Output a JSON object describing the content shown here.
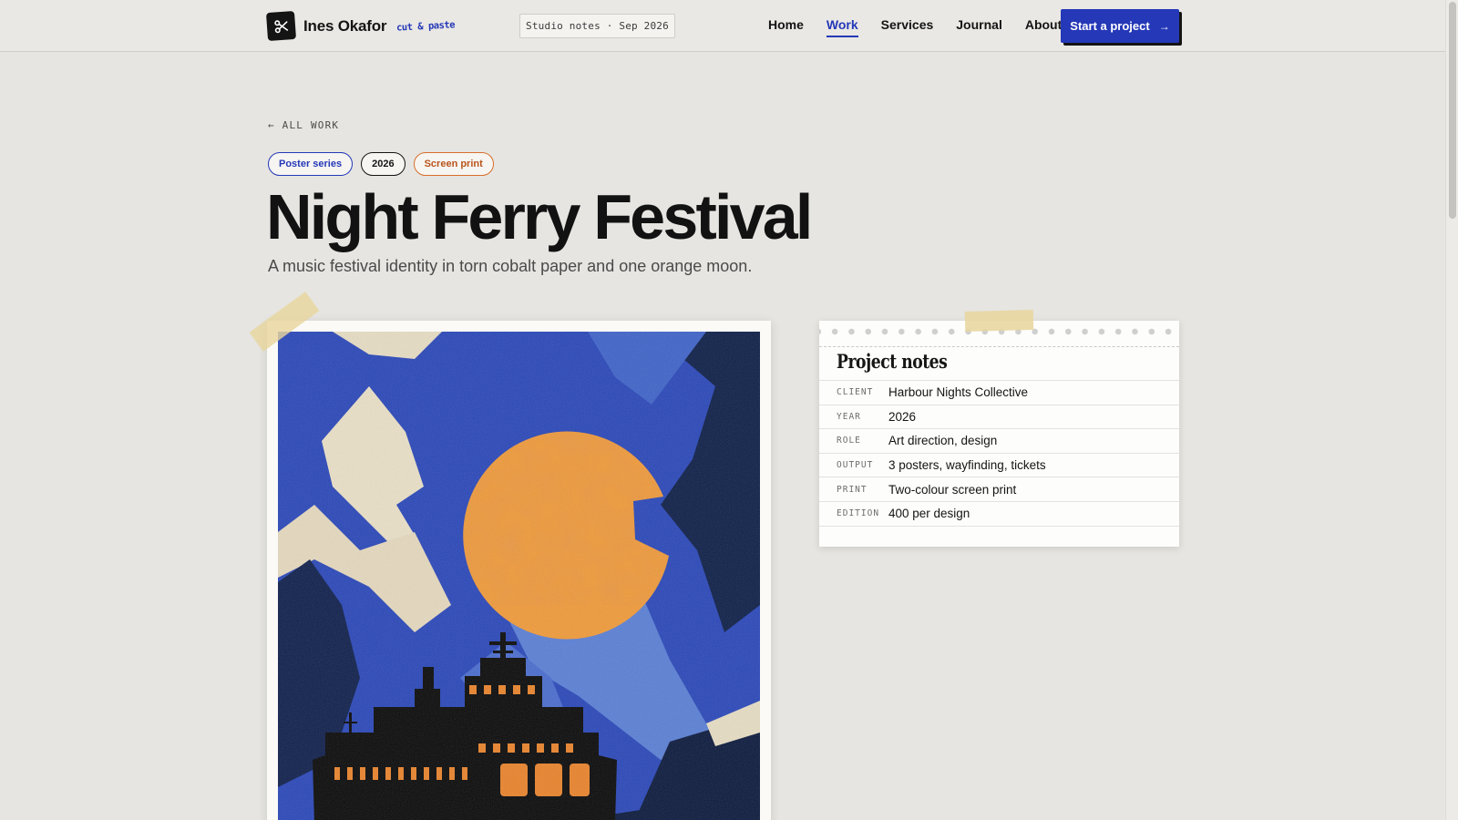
{
  "header": {
    "brand_name": "Ines Okafor",
    "brand_tagline": "cut & paste",
    "studio_chip": "Studio notes · Sep 2026",
    "nav": [
      {
        "label": "Home",
        "active": false
      },
      {
        "label": "Work",
        "active": true
      },
      {
        "label": "Services",
        "active": false
      },
      {
        "label": "Journal",
        "active": false
      },
      {
        "label": "About",
        "active": false
      }
    ],
    "cta_label": "Start a project"
  },
  "hero": {
    "back_label": "ALL WORK",
    "tags": [
      "Poster series",
      "2026",
      "Screen print"
    ],
    "title": "Night Ferry Festival",
    "subtitle": "A music festival identity in torn cobalt paper and one orange moon."
  },
  "notes": {
    "title": "Project notes",
    "rows": [
      {
        "key": "CLIENT",
        "value": "Harbour Nights Collective"
      },
      {
        "key": "YEAR",
        "value": "2026"
      },
      {
        "key": "ROLE",
        "value": "Art direction, design"
      },
      {
        "key": "OUTPUT",
        "value": "3 posters, wayfinding, tickets"
      },
      {
        "key": "PRINT",
        "value": "Two-colour screen print"
      },
      {
        "key": "EDITION",
        "value": "400 per design"
      }
    ]
  },
  "colors": {
    "accent": "#2538b8",
    "ink": "#141414",
    "orange": "#e8832c",
    "paper": "#e6e5e1"
  },
  "icons": {
    "brand": "scissors-icon",
    "back": "arrow-left-icon",
    "cta": "arrow-right-icon"
  }
}
